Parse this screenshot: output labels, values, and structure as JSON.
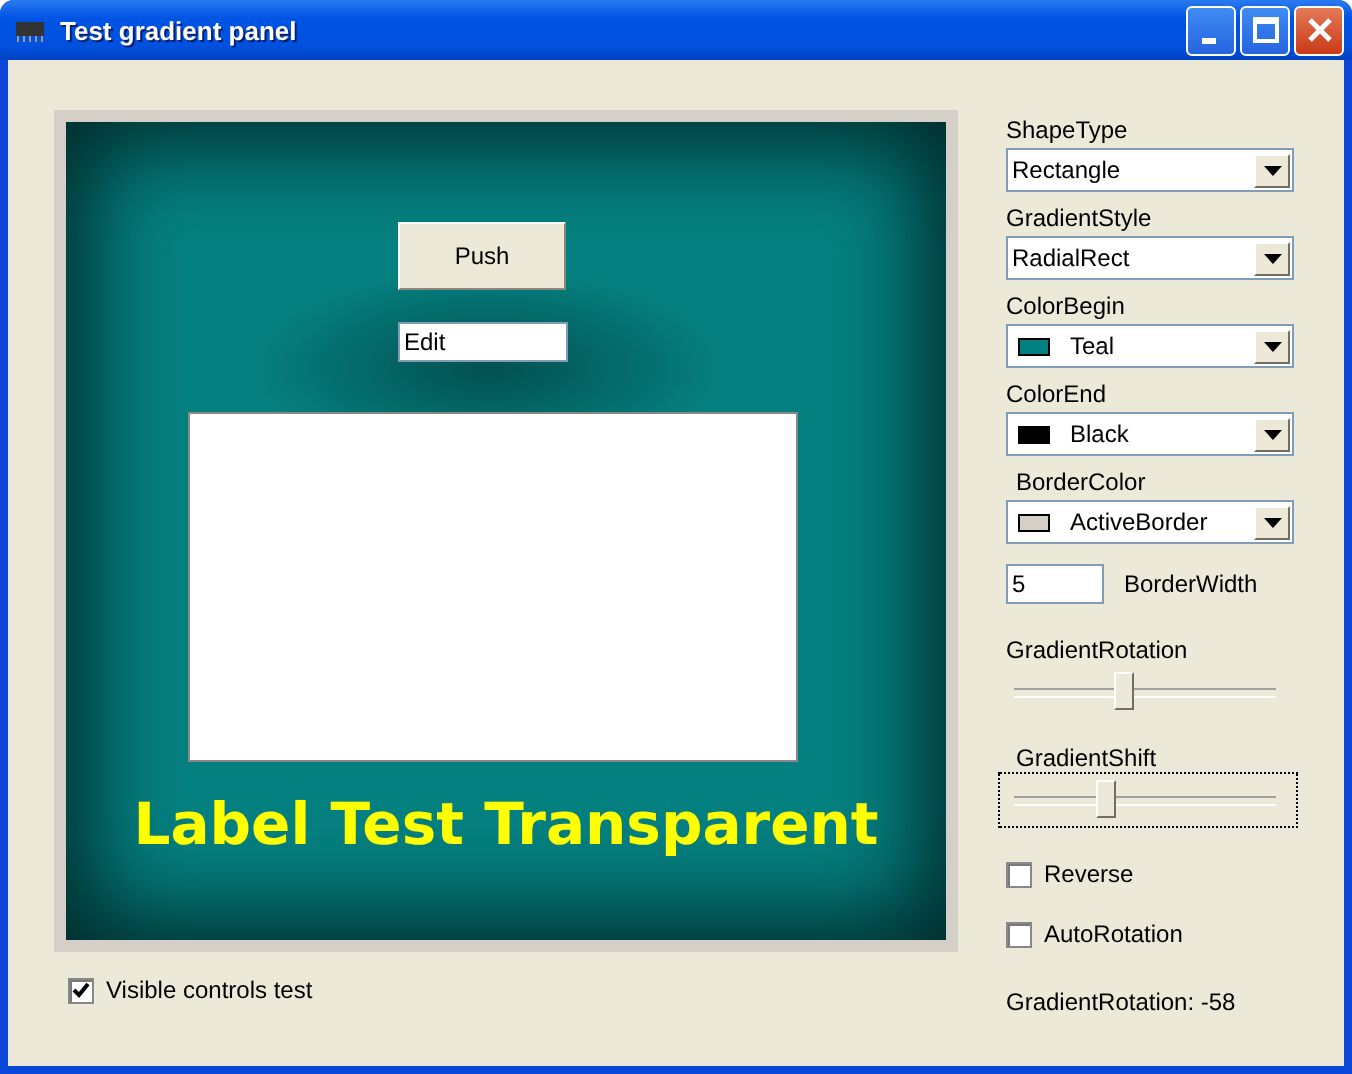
{
  "window": {
    "title": "Test gradient panel"
  },
  "panel": {
    "push_button": "Push",
    "edit_field": "Edit",
    "label": "Label Test Transparent"
  },
  "visible_checkbox": {
    "label": "Visible controls test",
    "checked": true
  },
  "settings": [
    {
      "kind": "combo",
      "label": "ShapeType",
      "value": "Rectangle"
    },
    {
      "kind": "combo",
      "label": "GradientStyle",
      "value": "RadialRect"
    },
    {
      "kind": "combo",
      "label": "ColorBegin",
      "value": "Teal",
      "color": "#008080"
    },
    {
      "kind": "combo",
      "label": "ColorEnd",
      "value": "Black",
      "color": "#000000"
    },
    {
      "kind": "combo",
      "label": "BorderColor",
      "value": "ActiveBorder",
      "color": "#d4d0c8"
    },
    {
      "kind": "number",
      "value": "5",
      "caption": "BorderWidth"
    },
    {
      "kind": "slider",
      "label": "GradientRotation",
      "level": 0.42,
      "focused": false
    },
    {
      "kind": "slider",
      "label": "GradientShift",
      "level": 0.35,
      "focused": true
    },
    {
      "kind": "checkbox",
      "label": "Reverse",
      "checked": false
    },
    {
      "kind": "checkbox",
      "label": "AutoRotation",
      "checked": false
    },
    {
      "kind": "status",
      "text": "GradientRotation: -58"
    }
  ]
}
